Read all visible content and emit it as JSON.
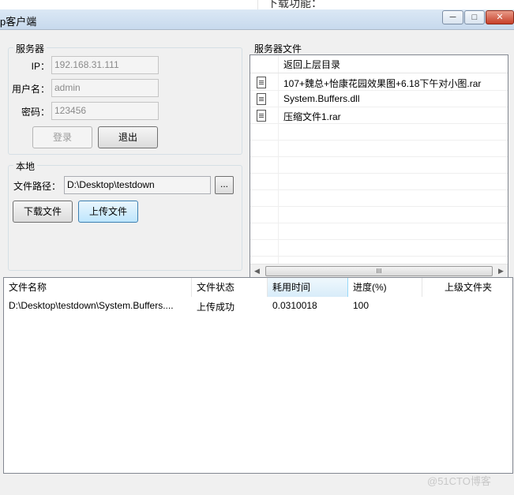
{
  "background": {
    "partial_text": "下载功能："
  },
  "window": {
    "title": "p客户端",
    "controls": {
      "minimize": "─",
      "maximize": "□",
      "close": "✕"
    }
  },
  "server_group": {
    "title": "服务器",
    "ip_label": "IP：",
    "ip_value": "192.168.31.111",
    "user_label": "用户名：",
    "user_value": "admin",
    "password_label": "密码：",
    "password_value": "123456",
    "login_label": "登录",
    "logout_label": "退出"
  },
  "local_group": {
    "title": "本地",
    "path_label": "文件路径：",
    "path_value": "D:\\Desktop\\testdown",
    "browse_label": "...",
    "download_label": "下载文件",
    "upload_label": "上传文件"
  },
  "server_files": {
    "title": "服务器文件",
    "parent_dir": "返回上层目录",
    "files": [
      {
        "name": "107+魏总+怡康花园效果图+6.18下午对小图.rar",
        "icon": "document-icon"
      },
      {
        "name": "System.Buffers.dll",
        "icon": "document-icon"
      },
      {
        "name": "压缩文件1.rar",
        "icon": "document-icon"
      }
    ],
    "scroll_left": "◀",
    "scroll_right": "▶",
    "thumb_grip": "III"
  },
  "transfers": {
    "columns": [
      "文件名称",
      "文件状态",
      "耗用时间",
      "进度(%)",
      "上级文件夹"
    ],
    "rows": [
      {
        "name": "D:\\Desktop\\testdown\\System.Buffers....",
        "status": "上传成功",
        "time": "0.0310018",
        "progress": "100",
        "parent": ""
      }
    ]
  },
  "watermark": "@51CTO博客"
}
